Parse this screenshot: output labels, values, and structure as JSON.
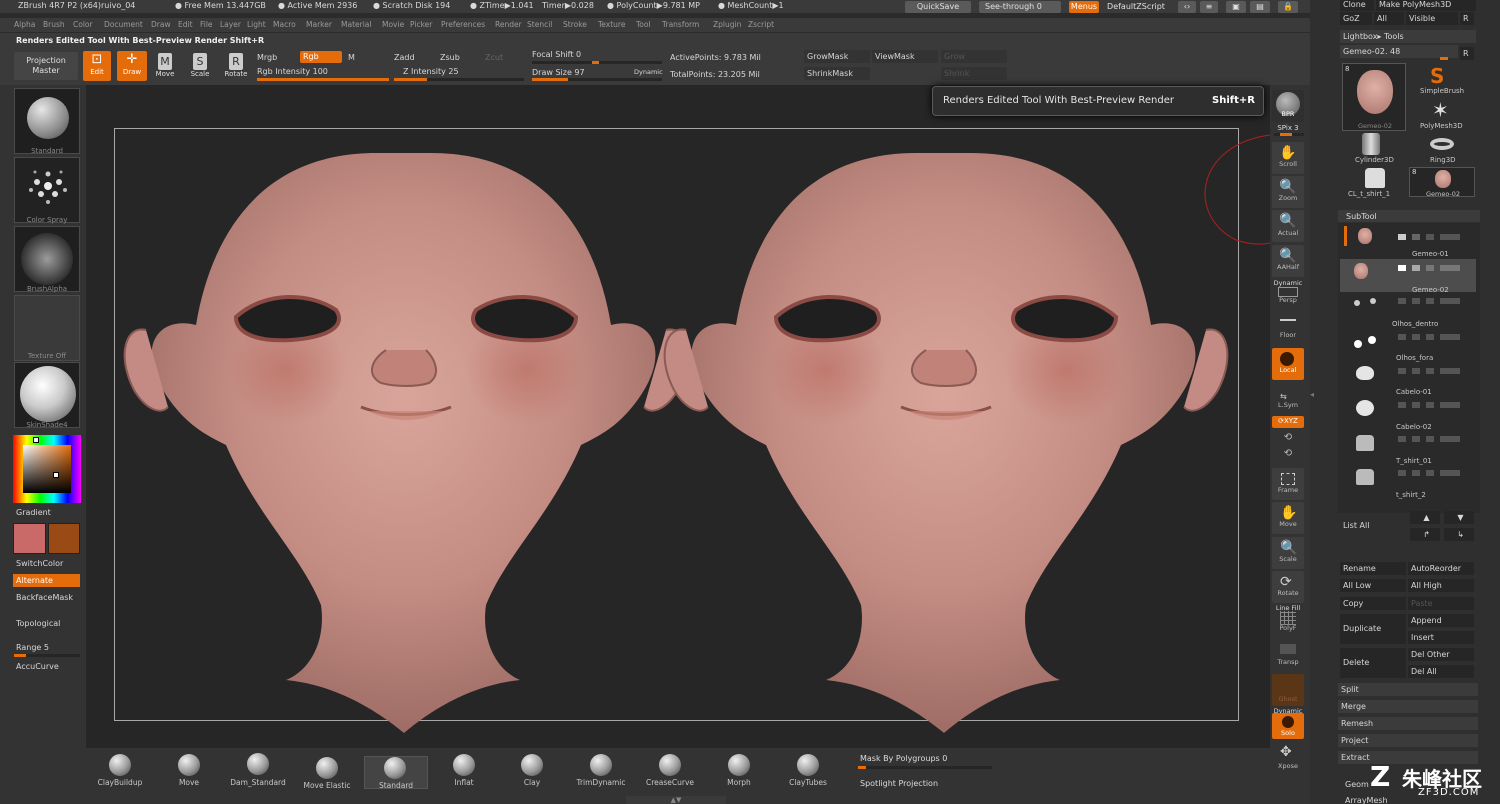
{
  "status_bar": {
    "app": "ZBrush 4R7 P2 (x64)ruivo_04",
    "free_mem": "● Free Mem 13.447GB",
    "active_mem": "● Active Mem 2936",
    "scratch_disk": "● Scratch Disk 194",
    "ztime": "● ZTime▶1.041",
    "timer": "Timer▶0.028",
    "polycount": "● PolyCount▶9.781 MP",
    "meshcount": "● MeshCount▶1"
  },
  "header": {
    "quicksave": "QuickSave",
    "see_through": "See-through  0",
    "menus": "Menus",
    "default_zscript": "DefaultZScript"
  },
  "menu": [
    "Alpha",
    "Brush",
    "Color",
    "Document",
    "Draw",
    "Edit",
    "File",
    "Layer",
    "Light",
    "Macro",
    "Marker",
    "Material",
    "Movie",
    "Picker",
    "Preferences",
    "Render",
    "Stencil",
    "Stroke",
    "Texture",
    "Tool",
    "Transform",
    "Zplugin",
    "Zscript"
  ],
  "tooltip_bar": "Renders Edited Tool With Best-Preview Render  Shift+R",
  "toolbar": {
    "projection_master": [
      "Projection",
      "Master"
    ],
    "edit": "Edit",
    "draw": "Draw",
    "move": "Move",
    "scale": "Scale",
    "rotate": "Rotate",
    "mrgb": "Mrgb",
    "rgb": "Rgb",
    "m": "M",
    "rgb_intensity": "Rgb Intensity 100",
    "zadd": "Zadd",
    "zsub": "Zsub",
    "zcut": "Zcut",
    "z_intensity": "Z Intensity 25",
    "focal_shift": "Focal Shift 0",
    "draw_size": "Draw Size 97",
    "dynamic": "Dynamic",
    "active_points": "ActivePoints: 9.783 Mil",
    "total_points": "TotalPoints: 23.205 Mil",
    "grow_mask": "GrowMask",
    "view_mask": "ViewMask",
    "grow": "Grow",
    "shrink_mask": "ShrinkMask",
    "shrink": "Shrink",
    "rgb_intensity_pct": 100,
    "z_intensity_pct": 25,
    "draw_size_pct": 28
  },
  "tooltip": {
    "text": "Renders Edited Tool With Best-Preview Render",
    "shortcut": "Shift+R"
  },
  "left_shelf": {
    "standard": "Standard",
    "color_spray": "Color Spray",
    "brush_alpha": "BrushAlpha",
    "texture_off": "Texture Off",
    "skinshade": "SkinShade4",
    "gradient": "Gradient",
    "switch_color": "SwitchColor",
    "alternate": "Alternate",
    "backface_mask": "BackfaceMask",
    "topological": "Topological",
    "range": "Range 5",
    "accucurve": "AccuCurve",
    "main_color": "#c96a68",
    "secondary_color": "#9a4a14"
  },
  "right_shelf": {
    "bpr": "BPR",
    "spix": "SPix 3",
    "scroll": "Scroll",
    "zoom": "Zoom",
    "actual": "Actual",
    "aahalf": "AAHalf",
    "dynamic": "Dynamic",
    "persp": "Persp",
    "floor": "Floor",
    "local": "Local",
    "lsym": "L.Sym",
    "xyz": "⟳XYZ",
    "frame": "Frame",
    "move": "Move",
    "scale": "Scale",
    "rotate": "Rotate",
    "line_fill": "Line Fill",
    "polyf": "PolyF",
    "transp": "Transp",
    "ghost": "Ghost",
    "dynamic2": "Dynamic",
    "solo": "Solo",
    "xpose": "Xpose"
  },
  "tray": {
    "clone": "Clone",
    "make_polymesh": "Make PolyMesh3D",
    "goz": "GoZ",
    "all": "All",
    "visible": "Visible",
    "r": "R",
    "lightbox_tools": "Lightbox▸ Tools",
    "current_tool": "Gemeo-02. 48",
    "r2": "R",
    "tools": [
      "Gemeo-02",
      "SimpleBrush",
      "PolyMesh3D",
      "Cylinder3D",
      "Ring3D",
      "CL_t_shirt_1",
      "Gemeo-02"
    ],
    "tool_counts": [
      "8",
      "8"
    ],
    "subtool_header": "SubTool",
    "subtools": [
      "Gemeo-01",
      "Gemeo-02",
      "Olhos_dentro",
      "Olhos_fora",
      "Cabelo-01",
      "Cabelo-02",
      "T_shirt_01",
      "t_shirt_2"
    ],
    "list_all": "List All",
    "rename": "Rename",
    "auto_reorder": "AutoReorder",
    "all_low": "All Low",
    "all_high": "All High",
    "copy": "Copy",
    "paste": "Paste",
    "append": "Append",
    "duplicate": "Duplicate",
    "insert": "Insert",
    "del_other": "Del Other",
    "delete": "Delete",
    "del_all": "Del All",
    "split": "Split",
    "merge": "Merge",
    "remesh": "Remesh",
    "project": "Project",
    "extract": "Extract",
    "geometry": "Geom",
    "array_mesh": "ArrayMesh"
  },
  "bottom_shelf": {
    "brushes": [
      "ClayBuildup",
      "Move",
      "Dam_Standard",
      "Move Elastic",
      "Standard",
      "Inflat",
      "Clay",
      "TrimDynamic",
      "CreaseCurve",
      "Morph",
      "ClayTubes"
    ],
    "mask_by_polygroups": "Mask By Polygroups 0",
    "spotlight_projection": "Spotlight Projection"
  },
  "watermark": {
    "site": "朱峰社区",
    "domain": "ZF3D.COM"
  }
}
